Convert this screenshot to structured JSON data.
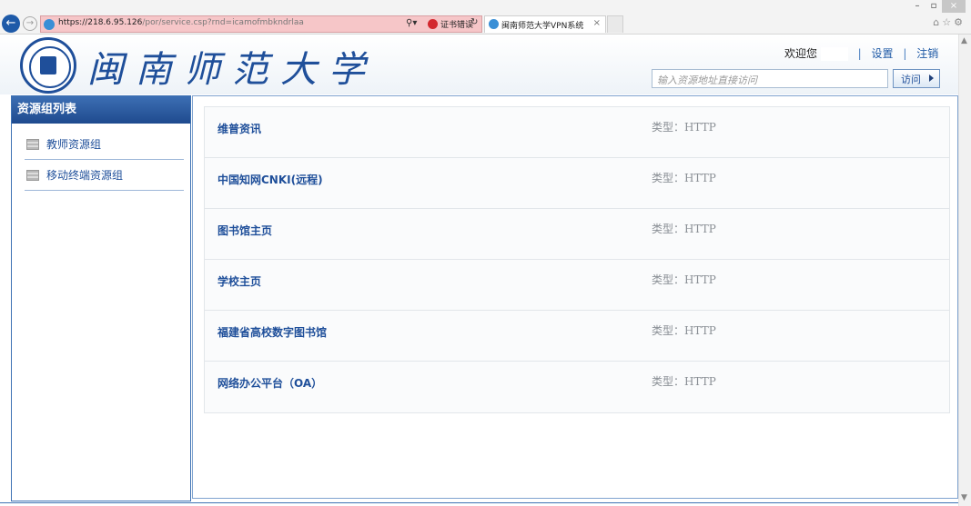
{
  "browser": {
    "url_host": "https://218.6.95.126",
    "url_path": "/por/service.csp?rnd=icamofmbkndrlaa",
    "cert_warning": "证书错误",
    "tab_title": "闽南师范大学VPN系统",
    "tab_close": "×",
    "win_minimize": "–",
    "win_restore": "▫",
    "win_close": "×",
    "right_icons": "⌂☆⚙"
  },
  "header": {
    "university_name": "闽南师范大学",
    "welcome": "欢迎您",
    "username": "",
    "settings_link": "设置",
    "logout_link": "注销",
    "separator": "|",
    "search_placeholder": "输入资源地址直接访问",
    "visit_button": "访问"
  },
  "sidebar": {
    "title": "资源组列表",
    "items": [
      {
        "label": "教师资源组"
      },
      {
        "label": "移动终端资源组"
      }
    ]
  },
  "resources": [
    {
      "name": "维普资讯",
      "type": "类型：HTTP"
    },
    {
      "name": "中国知网CNKI(远程)",
      "type": "类型：HTTP"
    },
    {
      "name": "图书馆主页",
      "type": "类型：HTTP"
    },
    {
      "name": "学校主页",
      "type": "类型：HTTP"
    },
    {
      "name": "福建省高校数字图书馆",
      "type": "类型：HTTP"
    },
    {
      "name": "网络办公平台（OA）",
      "type": "类型：HTTP"
    }
  ],
  "icons": {
    "back": "back-arrow-icon",
    "forward": "forward-arrow-icon",
    "emblem": "university-emblem-icon",
    "folder": "folder-icon",
    "visit_arrow": "play-arrow-icon"
  },
  "colors": {
    "brand_blue": "#1f4f9a",
    "sidebar_header": "#2c5ca0",
    "address_bar_error": "#f6c6c8",
    "type_text": "#8a8f95"
  }
}
